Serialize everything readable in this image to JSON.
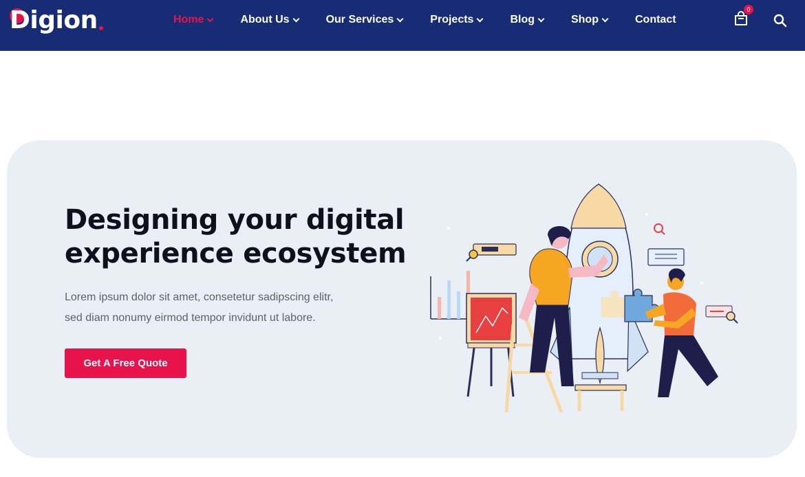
{
  "brand": {
    "name": "Digion",
    "accent": "#e8134b",
    "nav_bg": "#172c74"
  },
  "nav": {
    "items": [
      {
        "label": "Home",
        "has_dropdown": true,
        "active": true
      },
      {
        "label": "About Us",
        "has_dropdown": true
      },
      {
        "label": "Our Services",
        "has_dropdown": true
      },
      {
        "label": "Projects",
        "has_dropdown": true
      },
      {
        "label": "Blog",
        "has_dropdown": true
      },
      {
        "label": "Shop",
        "has_dropdown": true
      },
      {
        "label": "Contact",
        "has_dropdown": false
      }
    ],
    "cart": {
      "icon": "shopping-bag-icon",
      "count": "0"
    },
    "search": {
      "icon": "search-icon"
    }
  },
  "hero": {
    "title_line1": "Designing your digital",
    "title_line2": "experience ecosystem",
    "subtitle_line1": "Lorem ipsum dolor sit amet, consetetur sadipscing elitr,",
    "subtitle_line2": "sed diam nonumy eirmod tempor invidunt ut labore.",
    "cta_label": "Get A Free Quote",
    "illustration": "rocket-launch-team-illustration"
  }
}
